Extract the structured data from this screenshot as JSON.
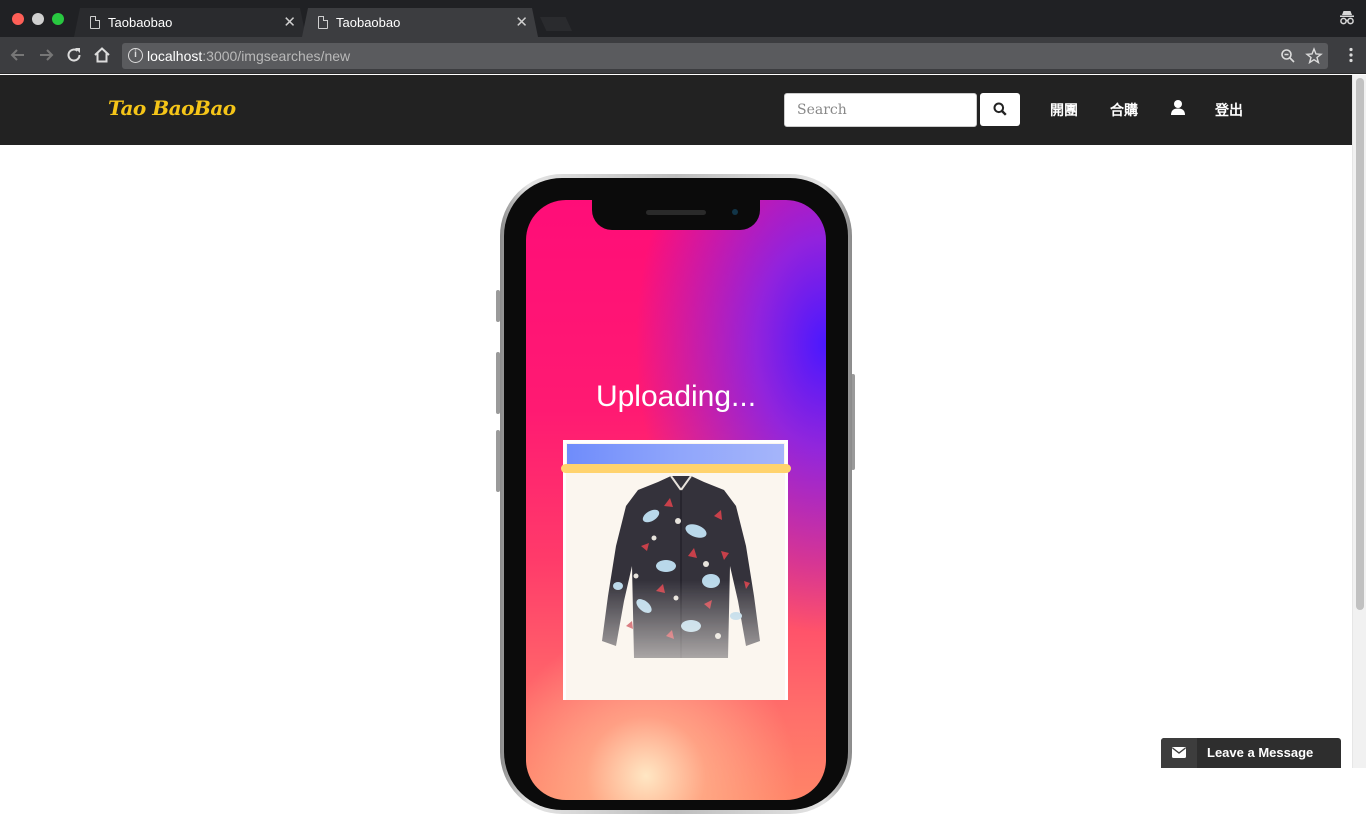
{
  "browser": {
    "tabs": [
      {
        "title": "Taobaobao",
        "active": false
      },
      {
        "title": "Taobaobao",
        "active": true
      }
    ],
    "url_host": "localhost",
    "url_path": ":3000/imgsearches/new"
  },
  "navbar": {
    "logo": "Tao BaoBao",
    "search_placeholder": "Search",
    "links": [
      "開團",
      "合購",
      "登出"
    ],
    "colors": {
      "background": "#222222",
      "logo": "#f5c518"
    }
  },
  "phone": {
    "status_text": "Uploading...",
    "upload_progress_color": "#7f98fb",
    "scan_line_color": "#ffd36e"
  },
  "chat_widget": {
    "label": "Leave a Message",
    "icon": "envelope-icon"
  }
}
